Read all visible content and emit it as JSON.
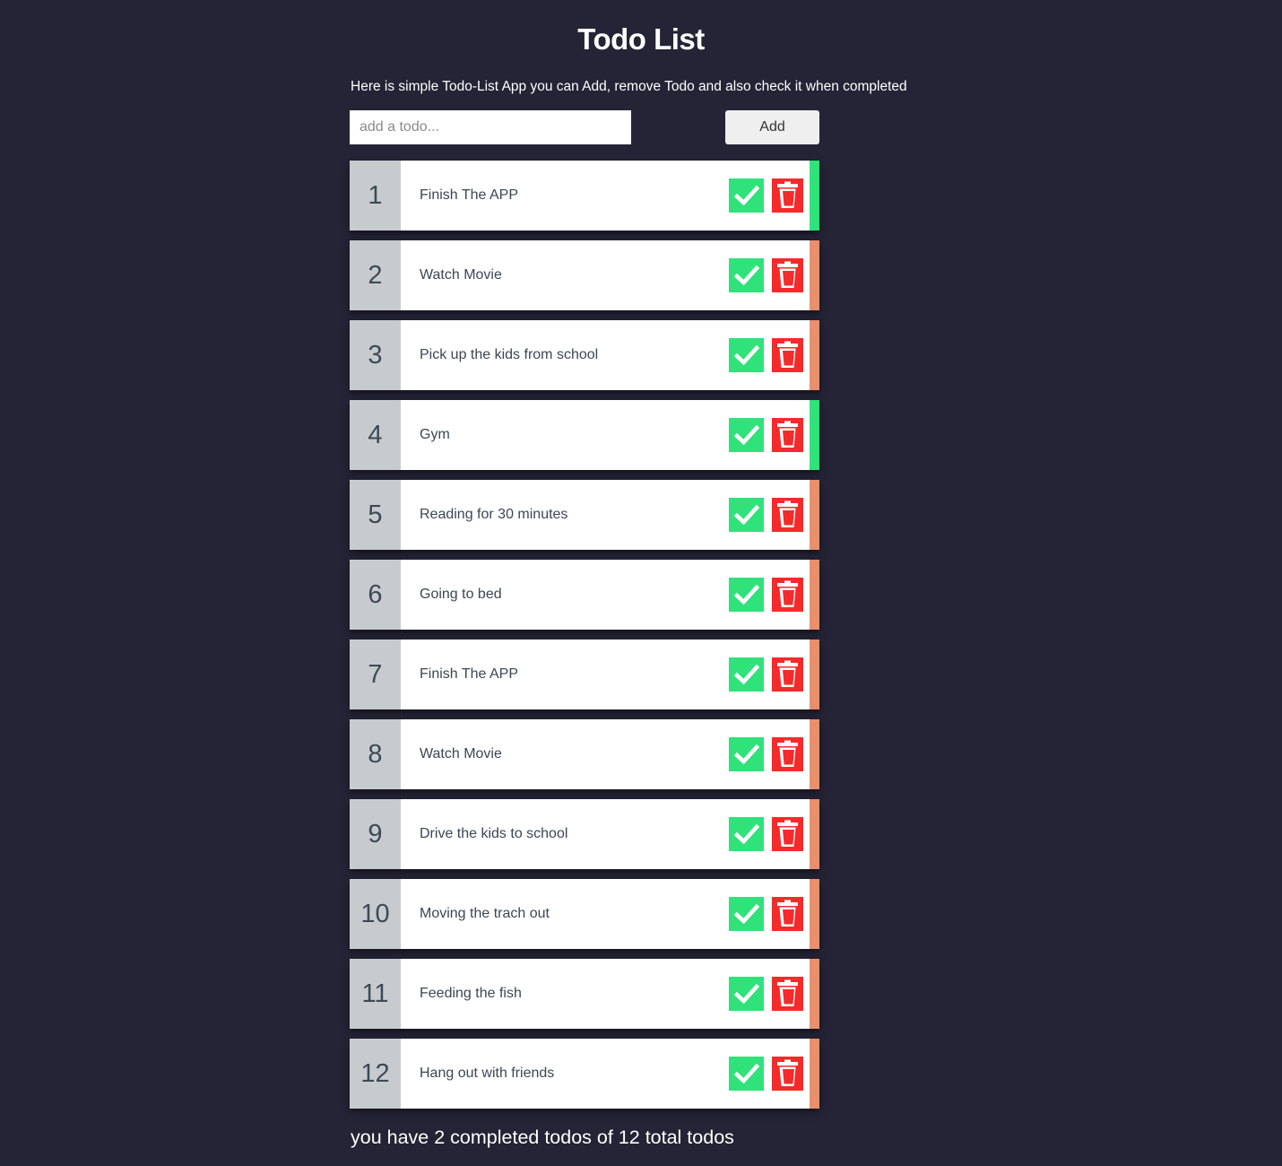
{
  "header": {
    "title": "Todo List",
    "subtitle": "Here is simple Todo-List App you can Add, remove Todo and also check it when completed"
  },
  "form": {
    "placeholder": "add a todo...",
    "value": "",
    "add_label": "Add"
  },
  "todos": [
    {
      "number": "1",
      "text": "Finish The APP",
      "completed": true
    },
    {
      "number": "2",
      "text": "Watch Movie",
      "completed": false
    },
    {
      "number": "3",
      "text": "Pick up the kids from school",
      "completed": false
    },
    {
      "number": "4",
      "text": "Gym",
      "completed": true
    },
    {
      "number": "5",
      "text": "Reading for 30 minutes",
      "completed": false
    },
    {
      "number": "6",
      "text": "Going to bed",
      "completed": false
    },
    {
      "number": "7",
      "text": "Finish The APP",
      "completed": false
    },
    {
      "number": "8",
      "text": "Watch Movie",
      "completed": false
    },
    {
      "number": "9",
      "text": "Drive the kids to school",
      "completed": false
    },
    {
      "number": "10",
      "text": "Moving the trach out",
      "completed": false
    },
    {
      "number": "11",
      "text": "Feeding the fish",
      "completed": false
    },
    {
      "number": "12",
      "text": "Hang out with friends",
      "completed": false
    }
  ],
  "icons": {
    "check": "check-icon",
    "delete": "trash-icon"
  },
  "colors": {
    "background": "#242436",
    "completed": "#2fe27a",
    "pending": "#e8906e",
    "check_button": "#2fe27a",
    "delete_button": "#f52a2a"
  },
  "footer": {
    "summary": "you have 2 completed todos of 12 total todos"
  }
}
